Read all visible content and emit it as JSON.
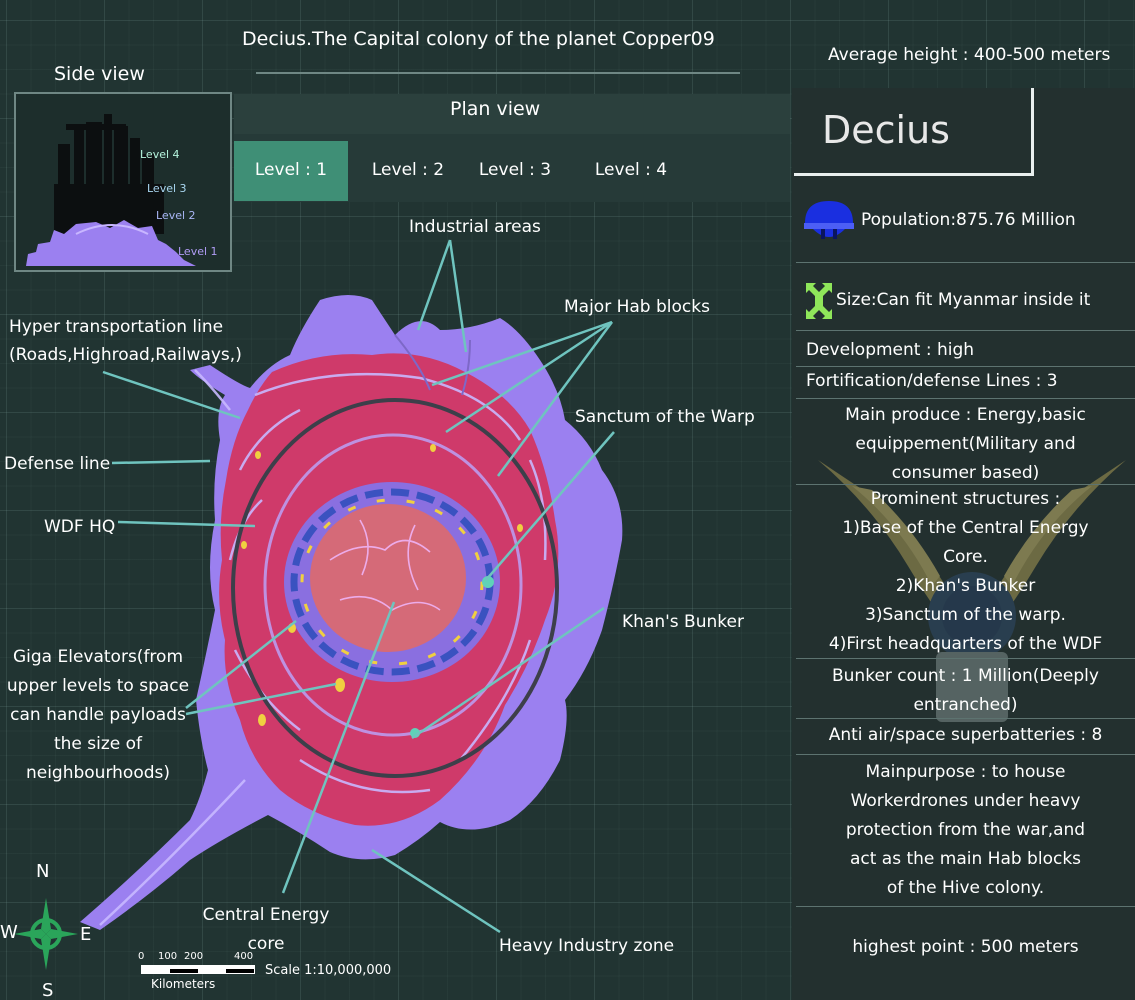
{
  "header": {
    "title": "Decius.The Capital colony of the planet Copper09",
    "average_height": "Average height : 400-500 meters"
  },
  "side_view": {
    "label": "Side view",
    "levels": [
      "Level 4",
      "Level 3",
      "Level 2",
      "Level 1"
    ]
  },
  "plan_view": {
    "title": "Plan view",
    "tabs": [
      "Level : 1",
      "Level : 2",
      "Level : 3",
      "Level : 4"
    ],
    "active_tab": "Level : 1"
  },
  "map_labels": {
    "industrial": "Industrial areas",
    "hab_blocks": "Major Hab blocks",
    "hyper_line_1": "Hyper transportation line",
    "hyper_line_2": "(Roads,Highroad,Railways,)",
    "sanctum": "Sanctum of the Warp",
    "defense": "Defense line",
    "wdf_hq": "WDF HQ",
    "khans_bunker": "Khan's Bunker",
    "giga_1": "Giga Elevators(from",
    "giga_2": "upper levels to space",
    "giga_3": "can handle payloads",
    "giga_4": "the size of",
    "giga_5": "neighbourhoods)",
    "core_1": "Central Energy",
    "core_2": "core",
    "heavy": "Heavy Industry zone"
  },
  "compass": {
    "n": "N",
    "w": "W",
    "e": "E",
    "s": "S"
  },
  "scale": {
    "ticks": [
      "0",
      "100",
      "200",
      "400"
    ],
    "units": "Kilometers",
    "ratio": "Scale 1:10,000,000"
  },
  "info_panel": {
    "name": "Decius",
    "population": "Population:875.76 Million",
    "size": "Size:Can fit Myanmar inside it",
    "development": "Development : high",
    "fortification": "Fortification/defense Lines : 3",
    "produce_1": "Main produce : Energy,basic",
    "produce_2": "equippement(Military and",
    "produce_3": "consumer based)",
    "structures_title": "Prominent structures :",
    "structures_1": "1)Base of the Central Energy",
    "structures_2": "Core.",
    "structures_3": "2)Khan's Bunker",
    "structures_4": "3)Sanctum of the warp.",
    "structures_5": "4)First headquarters of the WDF",
    "bunker_1": "Bunker count : 1 Million(Deeply",
    "bunker_2": "entranched)",
    "anti_air": "Anti air/space superbatteries : 8",
    "purpose_1": "Mainpurpose : to house",
    "purpose_2": "Workerdrones under heavy",
    "purpose_3": "protection from the war,and",
    "purpose_4": "act as the main Hab blocks",
    "purpose_5": "of the Hive colony.",
    "highest": "highest point : 500 meters"
  },
  "icons": {
    "population": "helmet-icon",
    "size": "size-arrows-icon",
    "emblem": "winged-emblem-icon",
    "compass": "compass-rose-icon"
  },
  "colors": {
    "background": "#213432",
    "active_tab": "#3f8f76",
    "city_purple": "#9b80f0",
    "city_red": "#cf3a6a",
    "core": "#d56a78",
    "leader_line": "#6fc4bf",
    "population_icon": "#1a2fe0",
    "size_icon": "#8fe65a",
    "compass": "#2aa55a"
  }
}
